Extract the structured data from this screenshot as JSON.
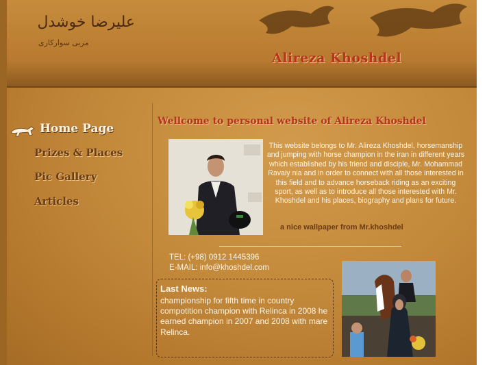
{
  "header": {
    "persian_title": "علیرضا خوشدل",
    "persian_subtitle": "مربی سوارکاری",
    "site_title": "Alireza Khoshdel"
  },
  "nav": {
    "home": "Home Page",
    "prizes": "Prizes & Places",
    "gallery": "Pic Gallery",
    "articles": "Articles"
  },
  "main": {
    "welcome": "Wellcome to personal website of Alireza Khoshdel",
    "intro": "This website belongs to Mr. Alireza Khoshdel, horsemanship and jumping with horse champion in the iran in different years which established by his friend and disciple, Mr. Mohammad Ravaiy nia and in order to connect with all those interested in this field and to advance horseback riding as an exciting sport, as well as to introduce all those interested with Mr. Khoshdel and his places, biography and plans for future.",
    "wallpaper_caption": "a nice wallpaper from Mr.khoshdel",
    "tel": "TEL: (+98) 0912 1445396",
    "email": "E-MAIL: info@khoshdel.com"
  },
  "news": {
    "title": "Last News:",
    "text": "championship for fifth time in country compotition champion with Relinca in 2008 he earned champion in 2007 and 2008 with mare Relinca."
  },
  "colors": {
    "title_red": "#b8341a",
    "nav_brown": "#6b3c14",
    "paper": "#c48a3c",
    "text_light": "#fff6e6"
  }
}
